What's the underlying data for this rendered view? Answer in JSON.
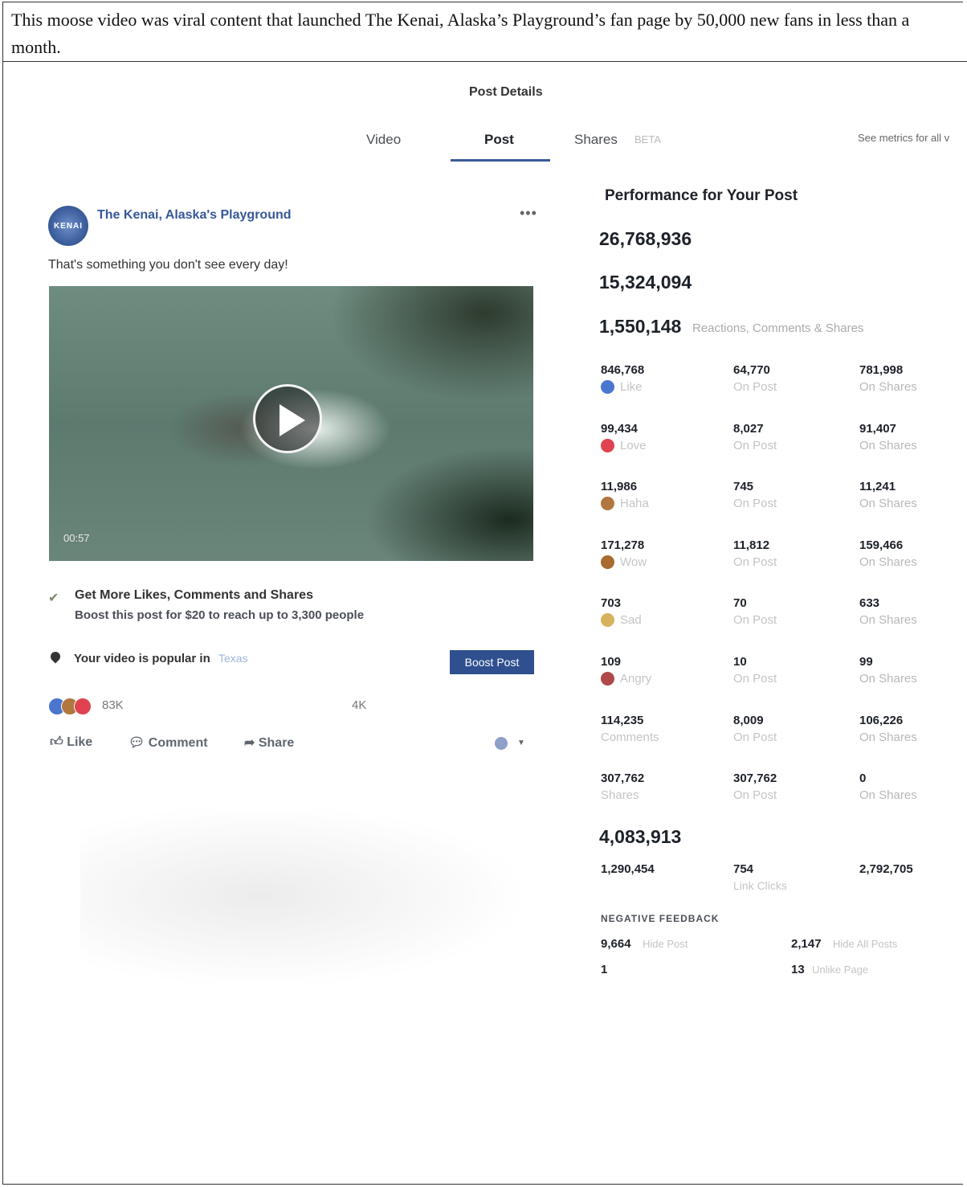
{
  "caption": "This moose video was viral content that launched The Kenai, Alaska’s Playground’s fan page by 50,000 new fans in less than a month.",
  "header": {
    "title": "Post Details",
    "tabs": [
      {
        "label": "Video"
      },
      {
        "label": "Post"
      },
      {
        "label": "Shares"
      }
    ],
    "beta": "BETA",
    "see_metrics": "See metrics for all v"
  },
  "post": {
    "avatar_text": "KENAI",
    "page_name": "The Kenai, Alaska's Playground",
    "text": "That's something you don't see every day!",
    "duration": "00:57",
    "promo_title": "Get More Likes, Comments and Shares",
    "promo_subtitle": "Boost this post for $20 to reach up to 3,300 people",
    "popular": "Your video is popular in",
    "boost_label": "Boost Post",
    "reaction_count": "83K",
    "shares_count": "4K",
    "actions": {
      "like": "Like",
      "comment": "Comment",
      "share": "Share"
    },
    "more": "•••"
  },
  "performance": {
    "title": "Performance for Your Post",
    "people_reached": "26,768,936",
    "video_views": "15,324,094",
    "engagement": "1,550,148",
    "engagement_label": "Reactions, Comments & Shares",
    "rows": [
      {
        "total": "846,768",
        "label": "Like",
        "post": "64,770",
        "post_label": "On Post",
        "shares": "781,998",
        "shares_label": "On Shares",
        "color": "#4a76d0"
      },
      {
        "total": "99,434",
        "label": "Love",
        "post": "8,027",
        "post_label": "On Post",
        "shares": "91,407",
        "shares_label": "On Shares",
        "color": "#e0434f"
      },
      {
        "total": "11,986",
        "label": "Haha",
        "post": "745",
        "post_label": "On Post",
        "shares": "11,241",
        "shares_label": "On Shares",
        "color": "#b07840"
      },
      {
        "total": "171,278",
        "label": "Wow",
        "post": "11,812",
        "post_label": "On Post",
        "shares": "159,466",
        "shares_label": "On Shares",
        "color": "#a86a30"
      },
      {
        "total": "703",
        "label": "Sad",
        "post": "70",
        "post_label": "On Post",
        "shares": "633",
        "shares_label": "On Shares",
        "color": "#d6b35a"
      },
      {
        "total": "109",
        "label": "Angry",
        "post": "10",
        "post_label": "On Post",
        "shares": "99",
        "shares_label": "On Shares",
        "color": "#b04848"
      },
      {
        "total": "114,235",
        "label": "Comments",
        "post": "8,009",
        "post_label": "On Post",
        "shares": "106,226",
        "shares_label": "On Shares",
        "color": ""
      },
      {
        "total": "307,762",
        "label": "Shares",
        "post": "307,762",
        "post_label": "On Post",
        "shares": "0",
        "shares_label": "On Shares",
        "color": ""
      }
    ],
    "clicks_total": "4,083,913",
    "clicks": [
      {
        "value": "1,290,454"
      },
      {
        "value": "754",
        "label": "Link Clicks"
      },
      {
        "value": "2,792,705"
      }
    ],
    "negative_title": "NEGATIVE FEEDBACK",
    "negative": [
      {
        "value": "9,664",
        "label": "Hide Post"
      },
      {
        "value": "2,147",
        "label": "Hide All Posts"
      },
      {
        "value": "1"
      },
      {
        "value": "13",
        "label": "Unlike Page"
      }
    ]
  }
}
